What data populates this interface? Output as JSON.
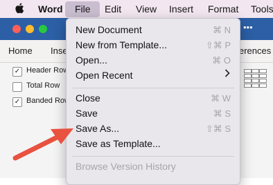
{
  "menubar": {
    "apple_icon": "apple-logo",
    "app_name": "Word",
    "items": [
      "File",
      "Edit",
      "View",
      "Insert",
      "Format",
      "Tools"
    ]
  },
  "window": {
    "qat_more": "•••",
    "tabs": {
      "home": "Home",
      "insert_partial": "Inse",
      "references_partial": "erences"
    }
  },
  "table_style_options": [
    {
      "label": "Header Row",
      "checked": true
    },
    {
      "label": "Total Row",
      "checked": false
    },
    {
      "label": "Banded Row",
      "checked": true
    }
  ],
  "file_menu": {
    "new_document": {
      "label": "New Document",
      "shortcut": "⌘ N"
    },
    "new_from_template": {
      "label": "New from Template...",
      "shortcut": "⇧⌘ P"
    },
    "open": {
      "label": "Open...",
      "shortcut": "⌘ O"
    },
    "open_recent": {
      "label": "Open Recent"
    },
    "close": {
      "label": "Close",
      "shortcut": "⌘ W"
    },
    "save": {
      "label": "Save",
      "shortcut": "⌘ S"
    },
    "save_as": {
      "label": "Save As...",
      "shortcut": "⇧⌘ S"
    },
    "save_as_template": {
      "label": "Save as Template..."
    },
    "browse_version_history": {
      "label": "Browse Version History"
    }
  },
  "colors": {
    "menubar_bg": "#f2e7f0",
    "file_highlight": "#c9bdd0",
    "titlebar": "#2c5fa6",
    "arrow": "#e8523f"
  }
}
